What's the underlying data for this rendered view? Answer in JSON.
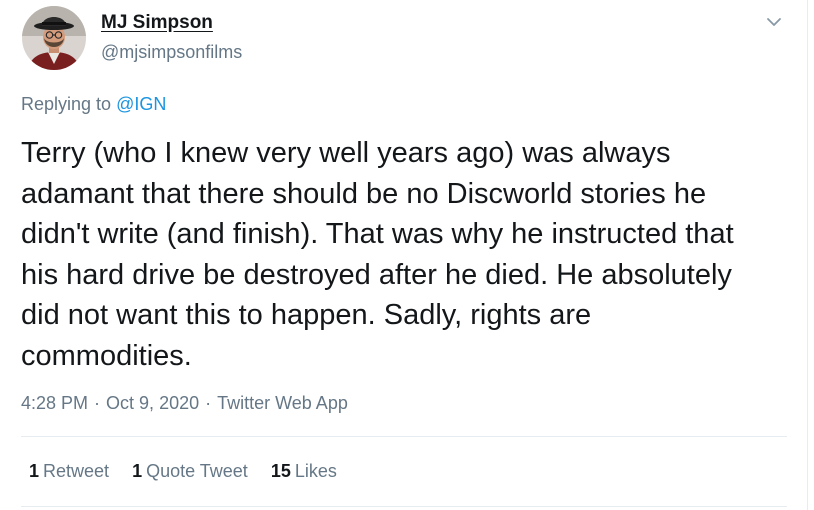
{
  "author": {
    "display_name": "MJ Simpson",
    "handle": "@mjsimpsonfilms",
    "avatar_icon": "profile-photo"
  },
  "reply": {
    "prefix": "Replying to",
    "mention": "@IGN"
  },
  "tweet": {
    "lines": [
      "Terry (who I knew very well years ago) was always",
      "adamant that there should be no Discworld stories he",
      "didn't write (and finish). That was why he instructed that",
      "his hard drive be destroyed after he died. He absolutely",
      "did not want this to happen. Sadly, rights are",
      "commodities."
    ]
  },
  "meta": {
    "time": "4:28 PM",
    "separator": "·",
    "date": "Oct 9, 2020",
    "source": "Twitter Web App"
  },
  "stats": {
    "retweets_count": "1",
    "retweets_label": "Retweet",
    "quotes_count": "1",
    "quotes_label": "Quote Tweet",
    "likes_count": "15",
    "likes_label": "Likes"
  },
  "colors": {
    "text": "#14171a",
    "secondary": "#657786",
    "link": "#1b95e0",
    "divider": "#e6ecf0"
  },
  "icons": {
    "menu": "chevron-down-icon"
  }
}
